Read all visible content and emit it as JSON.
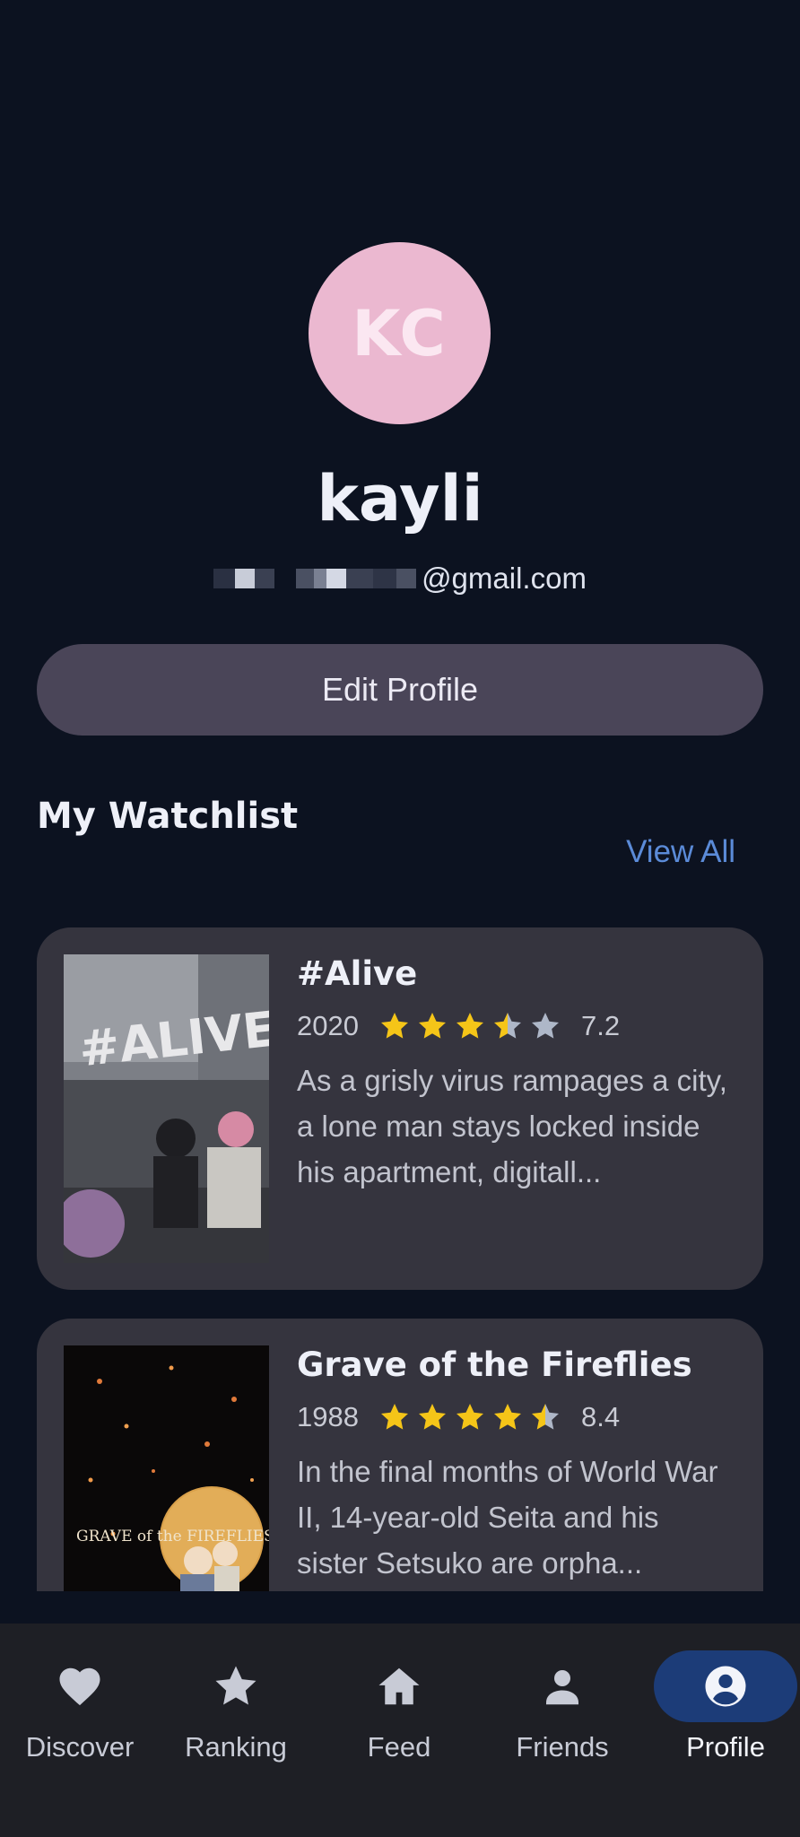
{
  "profile": {
    "initials": "KC",
    "username": "kayli",
    "email_suffix": "@gmail.com",
    "edit_label": "Edit Profile"
  },
  "watchlist": {
    "title": "My Watchlist",
    "view_all": "View All",
    "items": [
      {
        "title": "#Alive",
        "year": "2020",
        "rating": 7.2,
        "rating_text": "7.2",
        "stars": 3.5,
        "description": "As a grisly virus rampages a city, a lone man stays locked inside his apartment, digitall...",
        "poster_text": "#ALIVE"
      },
      {
        "title": "Grave of the Fireflies",
        "year": "1988",
        "rating": 8.4,
        "rating_text": "8.4",
        "stars": 4.5,
        "description": "In the final months of World War II, 14-year-old Seita and his sister Setsuko are orpha...",
        "poster_text": "GRAVE of the FIREFLIES"
      }
    ]
  },
  "nav": {
    "items": [
      {
        "label": "Discover",
        "icon": "heart-icon"
      },
      {
        "label": "Ranking",
        "icon": "star-icon"
      },
      {
        "label": "Feed",
        "icon": "home-icon"
      },
      {
        "label": "Friends",
        "icon": "person-icon"
      },
      {
        "label": "Profile",
        "icon": "account-circle-icon",
        "active": true
      }
    ]
  },
  "colors": {
    "background": "#0c1220",
    "avatar": "#ebb8d0",
    "accent": "#5b8bd8",
    "star": "#f5c518",
    "nav_active": "#1c3c78"
  }
}
